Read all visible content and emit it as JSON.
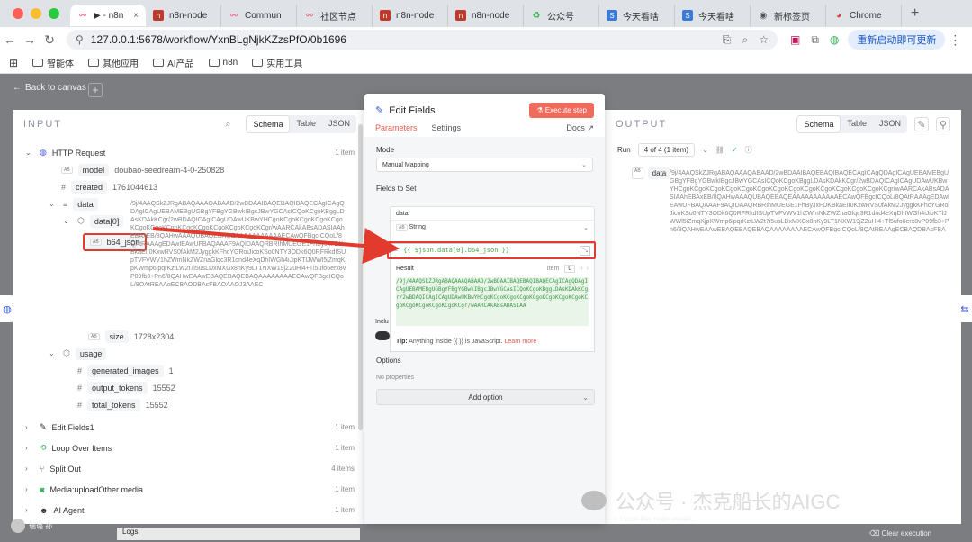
{
  "browser": {
    "tabs": [
      {
        "label": "▶ - n8n",
        "active": true
      },
      {
        "label": "n8n-node"
      },
      {
        "label": "Commun"
      },
      {
        "label": "社区节点"
      },
      {
        "label": "n8n-node"
      },
      {
        "label": "n8n-node"
      },
      {
        "label": "公众号"
      },
      {
        "label": "今天看啥"
      },
      {
        "label": "今天看啥"
      },
      {
        "label": "新标签页"
      },
      {
        "label": "Chrome"
      }
    ],
    "url": "127.0.0.1:5678/workflow/YxnBLgNjkKZzsPfO/0b1696",
    "update_label": "重新启动即可更新",
    "bookmarks": [
      "智能体",
      "其他应用",
      "AI产品",
      "n8n",
      "实用工具"
    ]
  },
  "canvas": {
    "back_label": "Back to canvas",
    "user_name": "瑞璐 孙",
    "logs_label": "Logs",
    "wish_label": "I wish this node would...",
    "clear_label": "Clear execution",
    "watermark": "公众号 · 杰克船长的AIGC"
  },
  "input": {
    "title": "INPUT",
    "views": [
      "Schema",
      "Table",
      "JSON"
    ],
    "nodes": [
      {
        "name": "HTTP Request",
        "count": "1 item"
      },
      {
        "name": "Edit Fields1",
        "count": "1 item"
      },
      {
        "name": "Loop Over Items",
        "count": "1 item"
      },
      {
        "name": "Split Out",
        "count": "4 items"
      },
      {
        "name": "Media:uploadOther media",
        "count": "1 item"
      },
      {
        "name": "AI Agent",
        "count": "1 item"
      }
    ],
    "fields": {
      "model_key": "model",
      "model_val": "doubao-seedream-4-0-250828",
      "created_key": "created",
      "created_val": "1761044613",
      "data_key": "data",
      "data0_key": "data[0]",
      "b64_key": "b64_json",
      "b64_val": "/9j/4AAQSkZJRgABAQAAAQABAAD/2wBDAAIBAQEBAQIBAQECAgICAgQDAgICAgUEBAMEBgUGBgYFBgYGBwkIBgcJBwYGCAsICQoKCgoKBggLDAsKDAkKCgr/2wBDAQICAgICAgUDAwUKBwYHCgoKCgoKCgoKCgoKCgoKCgoKCgoKCgoKCgoKCgoKCgoKCgoKCgoKCgr/wAARCAkABsADASIAAhEBAxEB/8QAHwAAAQUBAQEBAQEAAAAAAAAAAAECAwQFBgcICQoL/8QAtRAAAgEDAwIEAwUFBAQAAAF9AQIDAAQRBRIhMUEGE1FhByJxFDKBkaEII0KxwRVS0fAkM2JyggkKFhcYGRoiJicoKSo0NTY3ODk6Q0RFRkdISUpTVFVWV1hZWmNkZWZnaGlqc3R1dnd4eXqDhIWGh4iJipKTlJWWl5iZmqKjpKWmp6ipqrKztLW2t7i5usLDxMXGx8nKy9LT1NXW19jZ2uHi4+Tl5ufo6erx8vP09fb3+Pn6/8QAHwEAAwEBAQEBAQEBAQAAAAAAAAECAwQFBgcICQoL/8QAtREAAgECBAQDBAcFBAQAAQJ3AAEC",
      "size_key": "size",
      "size_val": "1728x2304",
      "usage_key": "usage",
      "gen_key": "generated_images",
      "gen_val": "1",
      "out_key": "output_tokens",
      "out_val": "15552",
      "tot_key": "total_tokens",
      "tot_val": "15552"
    }
  },
  "editor": {
    "title": "Edit Fields",
    "execute_label": "Execute step",
    "tabs": [
      "Parameters",
      "Settings"
    ],
    "docs_label": "Docs",
    "mode_label": "Mode",
    "mode_value": "Manual Mapping",
    "fields_label": "Fields to Set",
    "field_name": "data",
    "field_type": "String",
    "expression": "{{ $json.data[0].b64_json }}",
    "result_label": "Result",
    "item_label": "Item",
    "item_index": "0",
    "result_value": "/9j/4AAQSkZJRgABAQAAAQABAAD/2wBDAAIBAQEBAQIBAQECAgICAgQDAgICAgUEBAMEBgUGBgYFBgYGBwkIBgcJBwYGCAsICQoKCgoKBggLDAsKDAkKCgr/2wBDAQICAgICAgUDAwUKBwYHCgoKCgoKCgoKCgoKCgoKCgoKCgoKCgoKCgoKCgoKCgoKCgoKCgoKCgr/wAARCAkABsADASIAA",
    "tip_bold": "Tip:",
    "tip_text": "Anything inside {{ }} is JavaScript.",
    "learn_more": "Learn more",
    "incl_label": "Inclu",
    "options_label": "Options",
    "no_properties": "No properties",
    "add_option": "Add option"
  },
  "output": {
    "title": "OUTPUT",
    "views": [
      "Schema",
      "Table",
      "JSON"
    ],
    "run_label": "Run",
    "run_select": "4 of 4 (1 item)",
    "data_key": "data",
    "data_val": "/9j/4AAQSkZJRgABAQAAAQABAAD/2wBDAAIBAQEBAQIBAQECAgICAgQDAgICAgUEBAMEBgUGBgYFBgYGBwkIBgcJBwYGCAsICQoKCgoKBggLDAsKDAkKCgr/2wBDAQICAgICAgUDAwUKBwYHCgoKCgoKCgoKCgoKCgoKCgoKCgoKCgoKCgoKCgoKCgoKCgoKCgoKCgr/wAARCAkABsADASIAAhEBAxEB/8QAHwAAAQUBAQEBAQEAAAAAAAAAAAECAwQFBgcICQoL/8QAtRAAAgEDAwIEAwUFBAQAAAF9AQIDAAQRBRIhMUEGE1FhByJxFDKBkaEII0KxwRVS0fAkM2JyggkKFhcYGRoiJicoKSo0NTY3ODk6Q0RFRkdISUpTVFVWV1hZWmNkZWZnaGlqc3R1dnd4eXqDhIWGh4iJipKTlJWWl5iZmqKjpKWmp6ipqrKztLW2t7i5usLDxMXGx8nKy9LT1NXW19jZ2uHi4+Tl5ufo6erx8vP09fb3+Pn6/8QAHwEAAwEBAQEBAQEBAQAAAAAAAAECAwQFBgcICQoL/8QAtREAAgECBAQDBAcFBAQAAQJ3AAEC"
  },
  "colors": {
    "accent": "#e55a48",
    "highlight": "#e23b2e",
    "expression": "#4aa44a"
  }
}
